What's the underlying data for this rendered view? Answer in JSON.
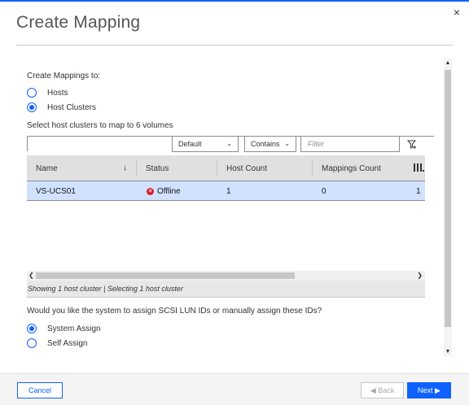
{
  "dialog": {
    "title": "Create Mapping",
    "close_glyph": "×"
  },
  "mapping_to": {
    "label": "Create Mappings to:",
    "options": [
      {
        "label": "Hosts",
        "selected": false
      },
      {
        "label": "Host Clusters",
        "selected": true
      }
    ]
  },
  "select_instruction": "Select host clusters to map to 6 volumes",
  "toolbar": {
    "view_select": "Default",
    "match_select": "Contains",
    "filter_placeholder": "Filter",
    "icons": [
      "filter-settings-icon"
    ]
  },
  "table": {
    "columns": [
      "Name",
      "Status",
      "Host Count",
      "Mappings Count"
    ],
    "sort_glyph": "↓",
    "rows": [
      {
        "name": "VS-UCS01",
        "status": "Offline",
        "host_count": "1",
        "mappings_count": "0",
        "extra": "1"
      }
    ]
  },
  "status_bar": "Showing 1 host cluster | Selecting 1 host cluster",
  "lun_question": "Would you like the system to assign SCSI LUN IDs or manually assign these IDs?",
  "assign": {
    "options": [
      {
        "label": "System Assign",
        "selected": true
      },
      {
        "label": "Self Assign",
        "selected": false
      }
    ]
  },
  "footer": {
    "cancel": "Cancel",
    "back": "◀ Back",
    "next": "Next ▶"
  },
  "colors": {
    "accent": "#0f62fe",
    "selected_row": "#d0e2ff",
    "error": "#da1e28"
  }
}
